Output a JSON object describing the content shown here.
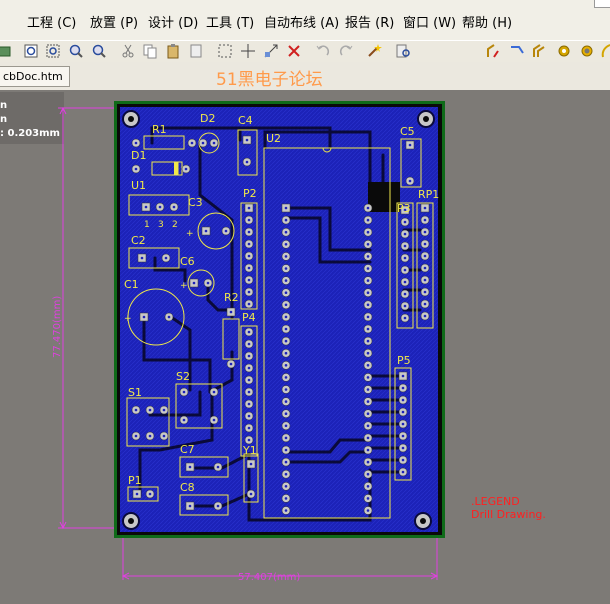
{
  "menu": [
    "工程 (C)",
    "放置 (P)",
    "设计 (D)",
    "工具 (T)",
    "自动布线 (A)",
    "报告 (R)",
    "窗口 (W)",
    "帮助 (H)"
  ],
  "tab": {
    "label": "cbDoc.htm",
    "watermark": "51黑电子论坛"
  },
  "info_panel": {
    "line1": "n",
    "line2": "n",
    "line3": ": 0.203mm"
  },
  "pcb": {
    "labels": {
      "R1": "R1",
      "D2": "D2",
      "C4": "C4",
      "U2": "U2",
      "C5": "C5",
      "D1": "D1",
      "U1": "U1",
      "C3": "C3",
      "P2": "P2",
      "P3": "P3",
      "RP1": "RP1",
      "C2": "C2",
      "C6": "C6",
      "C1": "C1",
      "R2": "R2",
      "P4": "P4",
      "P5": "P5",
      "S1": "S1",
      "S2": "S2",
      "C7": "C7",
      "Y1": "Y1",
      "C8": "C8",
      "P1": "P1",
      "u1_pin1": "1",
      "u1_pin3": "3",
      "u1_pin2": "2",
      "plus_c3": "+",
      "plus_c6": "+",
      "plus_c1": "+"
    },
    "legend_title": ".LEGEND",
    "legend_sub": "Drill Drawing.",
    "dim_vertical": "77.470(mm)",
    "dim_horizontal": "57.407(mm)"
  },
  "colors": {
    "board": "#1c22b8",
    "trace": "#0a0a3a",
    "silk": "#f0e84a",
    "pad": "#c8c8c8",
    "outline": "#0f6b19",
    "dimension": "#e040e0",
    "legend": "#ff2020"
  }
}
